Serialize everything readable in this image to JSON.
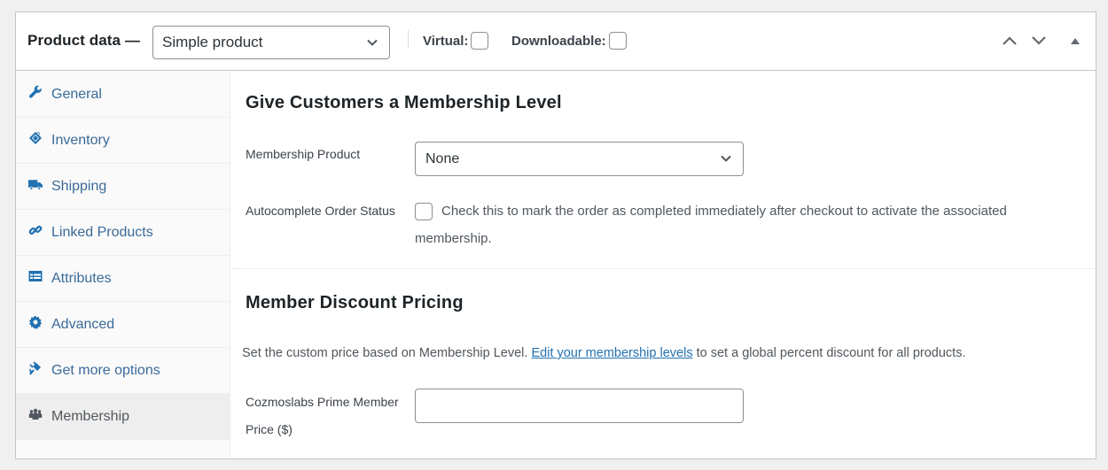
{
  "header": {
    "title": "Product data —",
    "product_type": "Simple product",
    "virtual_label": "Virtual:",
    "virtual_checked": false,
    "downloadable_label": "Downloadable:",
    "downloadable_checked": false,
    "move_up_icon": "chevron-up-icon",
    "move_down_icon": "chevron-down-icon",
    "toggle_icon": "triangle-up-icon"
  },
  "sidebar": {
    "items": [
      {
        "label": "General",
        "icon": "wrench-icon",
        "active": false
      },
      {
        "label": "Inventory",
        "icon": "tag-icon",
        "active": false
      },
      {
        "label": "Shipping",
        "icon": "truck-icon",
        "active": false
      },
      {
        "label": "Linked Products",
        "icon": "link-icon",
        "active": false
      },
      {
        "label": "Attributes",
        "icon": "list-view-icon",
        "active": false
      },
      {
        "label": "Advanced",
        "icon": "gear-icon",
        "active": false
      },
      {
        "label": "Get more options",
        "icon": "plugin-icon",
        "active": false
      },
      {
        "label": "Membership",
        "icon": "groups-icon",
        "active": true
      }
    ]
  },
  "main": {
    "membership_section": {
      "title": "Give Customers a Membership Level",
      "membership_product_label": "Membership Product",
      "membership_product_value": "None",
      "autocomplete_label": "Autocomplete Order Status",
      "autocomplete_checked": false,
      "autocomplete_description": "Check this to mark the order as completed immediately after checkout to activate the associated membership."
    },
    "discount_section": {
      "title": "Member Discount Pricing",
      "description_before": "Set the custom price based on Membership Level.",
      "link_text": "Edit your membership levels",
      "description_after": "to set a global percent discount for all products.",
      "price_label": "Cozmoslabs Prime Member Price ($)",
      "price_value": ""
    }
  },
  "colors": {
    "accent": "#2271b1",
    "border": "#c3c4c7",
    "background": "#f0f0f1"
  }
}
